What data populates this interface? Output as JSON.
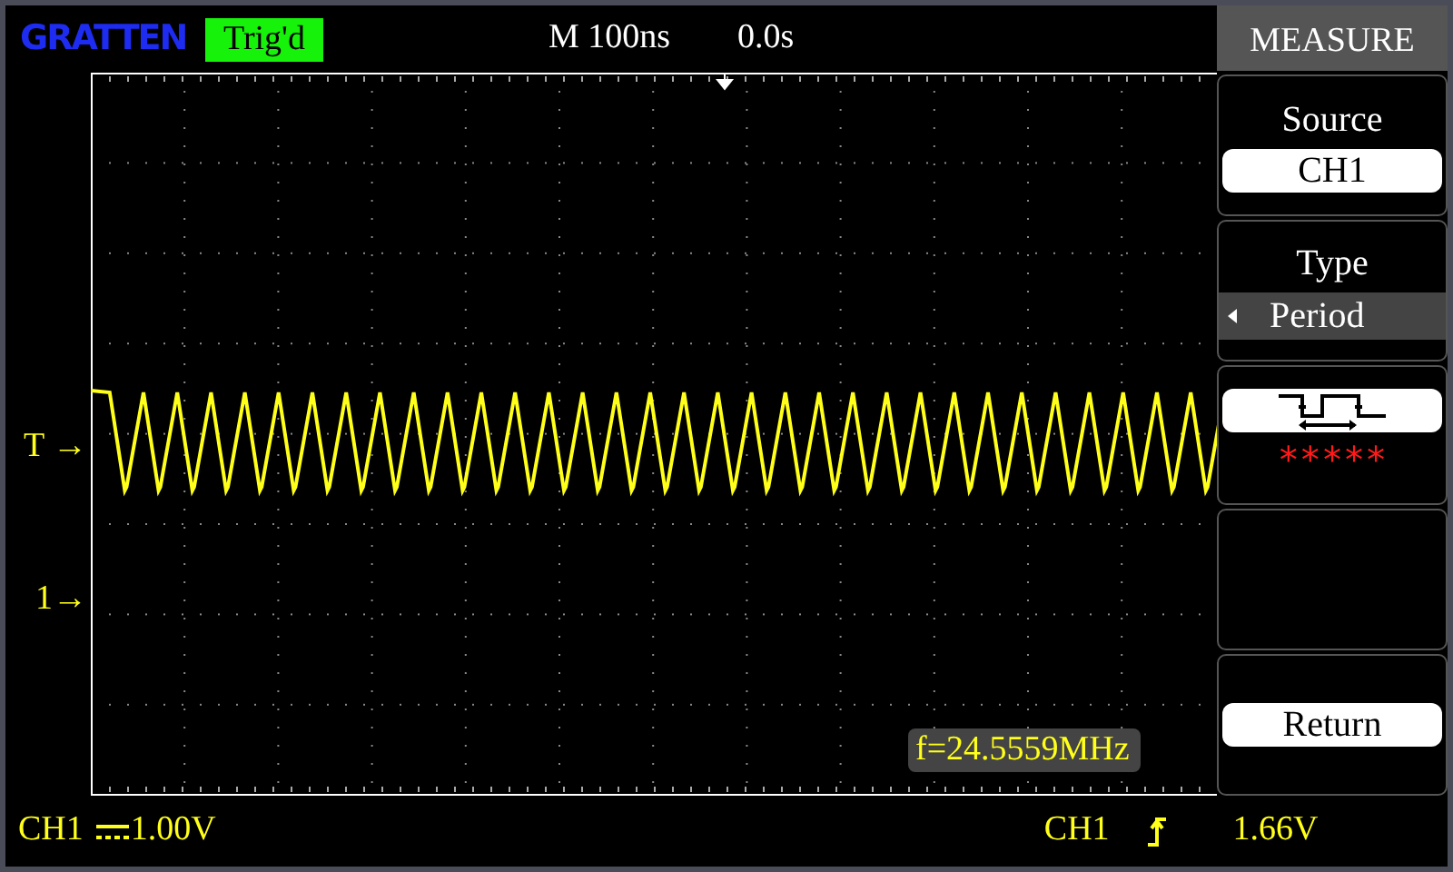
{
  "header": {
    "logo": "GRATTEN",
    "trigger_status": "Trig'd",
    "triggered": true,
    "timebase": "M 100ns",
    "trigger_position": "0.0s"
  },
  "screen": {
    "markers": [
      {
        "kind": "trigger-level",
        "label": "T →"
      },
      {
        "kind": "channel",
        "label": "1→"
      }
    ],
    "readout": "f=24.5559MHz"
  },
  "menu": {
    "title": "MEASURE",
    "items": [
      {
        "kind": "value",
        "label": "Source",
        "value": "CH1"
      },
      {
        "kind": "select",
        "label": "Type",
        "value": "Period"
      },
      {
        "kind": "reading",
        "value": "*****"
      },
      {
        "kind": "empty"
      },
      {
        "kind": "button",
        "label": "Return"
      }
    ]
  },
  "status_bar": {
    "channel": "CH1",
    "volts_per_div": "1.00V",
    "trigger_source": "CH1",
    "trigger_level": "1.66V"
  }
}
